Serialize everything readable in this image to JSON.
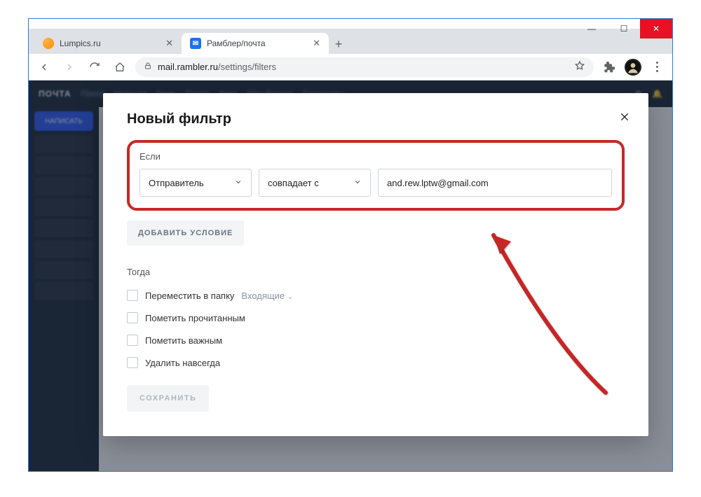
{
  "browser": {
    "tabs": [
      {
        "title": "Lumpics.ru",
        "active": false
      },
      {
        "title": "Рамблер/почта",
        "active": true
      }
    ],
    "url_host": "mail.rambler.ru",
    "url_path": "/settings/filters",
    "favicon_letter": "✉"
  },
  "window_controls": {
    "min": "—",
    "max": "☐",
    "close": "✕"
  },
  "background": {
    "brand": "ПОЧТА",
    "compose": "НАПИСАТЬ",
    "nav": [
      "Почта",
      "Новости",
      "Кино",
      "Спорт",
      "Авто",
      "Шоу-бизнес",
      "Гороскопы"
    ]
  },
  "modal": {
    "title": "Новый фильтр",
    "section_if": "Если",
    "select_field": "Отправитель",
    "select_op": "совпадает с",
    "input_value": "and.rew.lptw@gmail.com",
    "add_condition": "ДОБАВИТЬ УСЛОВИЕ",
    "section_then": "Тогда",
    "actions": {
      "move": "Переместить в папку",
      "move_folder": "Входящие",
      "read": "Пометить прочитанным",
      "important": "Пометить важным",
      "delete": "Удалить навсегда"
    },
    "save": "СОХРАНИТЬ"
  }
}
